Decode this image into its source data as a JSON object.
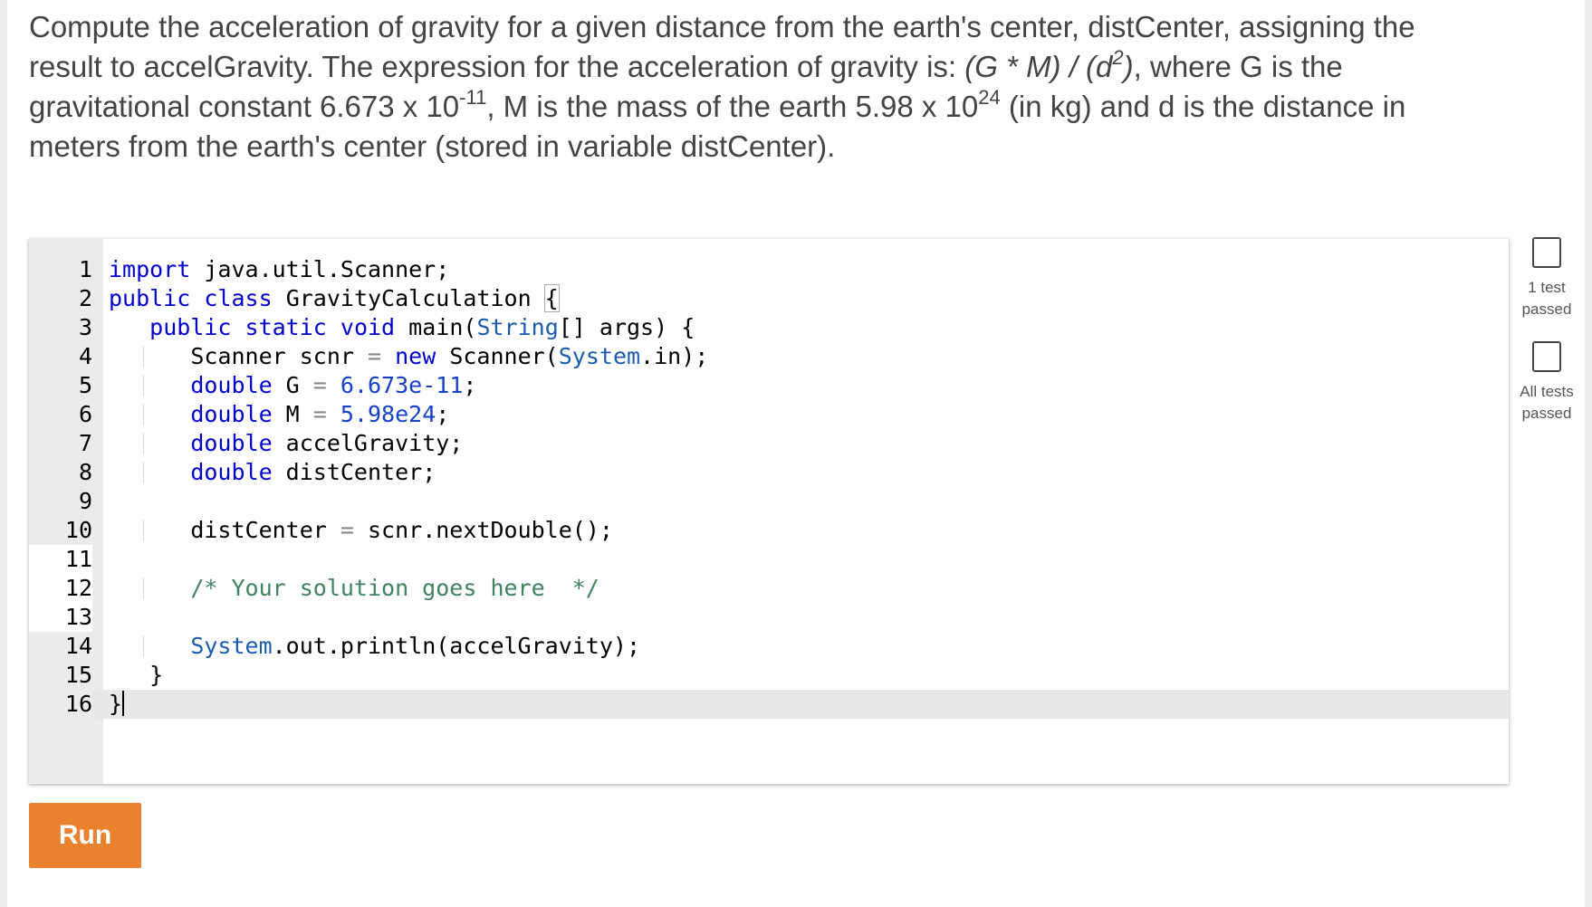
{
  "prompt": {
    "text1": "Compute the acceleration of gravity for a given distance from the earth's center, distCenter, assigning the result to accelGravity. The expression for the acceleration of gravity is: ",
    "formula_a": "(G * M) / (d",
    "formula_sup": "2",
    "formula_b": ")",
    "text2": ", where G is the gravitational constant 6.673 x 10",
    "exp1": "-11",
    "text3": ", M is the mass of the earth 5.98 x 10",
    "exp2": "24",
    "text4": " (in kg) and d is the distance in meters from the earth's center (stored in variable distCenter)."
  },
  "editor": {
    "line_numbers": [
      "1",
      "2",
      "3",
      "4",
      "5",
      "6",
      "7",
      "8",
      "9",
      "10",
      "11",
      "12",
      "13",
      "14",
      "15",
      "16"
    ],
    "l1": {
      "kw": "import",
      "rest": " java.util.Scanner;"
    },
    "l2": {
      "kw1": "public",
      "kw2": "class",
      "name": " GravityCalculation ",
      "brace": "{"
    },
    "l3": {
      "kw1": "public",
      "kw2": "static",
      "kw3": "void",
      "a": " main(",
      "type": "String",
      "b": "[] args) {"
    },
    "l4": {
      "a": "Scanner scnr ",
      "op": "=",
      "kw": "new",
      "b": " Scanner(",
      "type": "System",
      "c": ".in);"
    },
    "l5": {
      "kw": "double",
      "a": " G ",
      "op": "=",
      "num": "6.673e-11",
      "b": ";"
    },
    "l6": {
      "kw": "double",
      "a": " M ",
      "op": "=",
      "num": "5.98e24",
      "b": ";"
    },
    "l7": {
      "kw": "double",
      "a": " accelGravity;"
    },
    "l8": {
      "kw": "double",
      "a": " distCenter;"
    },
    "l10": {
      "a": "distCenter ",
      "op": "=",
      "b": " scnr.nextDouble();"
    },
    "l12": {
      "cmt": "/* Your solution goes here  */"
    },
    "l14": {
      "type": "System",
      "a": ".out.println(accelGravity);"
    },
    "l15": {
      "a": "}"
    },
    "l16": {
      "a": "}"
    }
  },
  "run_label": "Run",
  "tests": [
    {
      "label_1": "1 test",
      "label_2": "passed"
    },
    {
      "label_1": "All tests",
      "label_2": "passed"
    }
  ],
  "colors": {
    "run_button": "#e8822e",
    "keyword": "#0000d0",
    "comment": "#3f8360"
  }
}
